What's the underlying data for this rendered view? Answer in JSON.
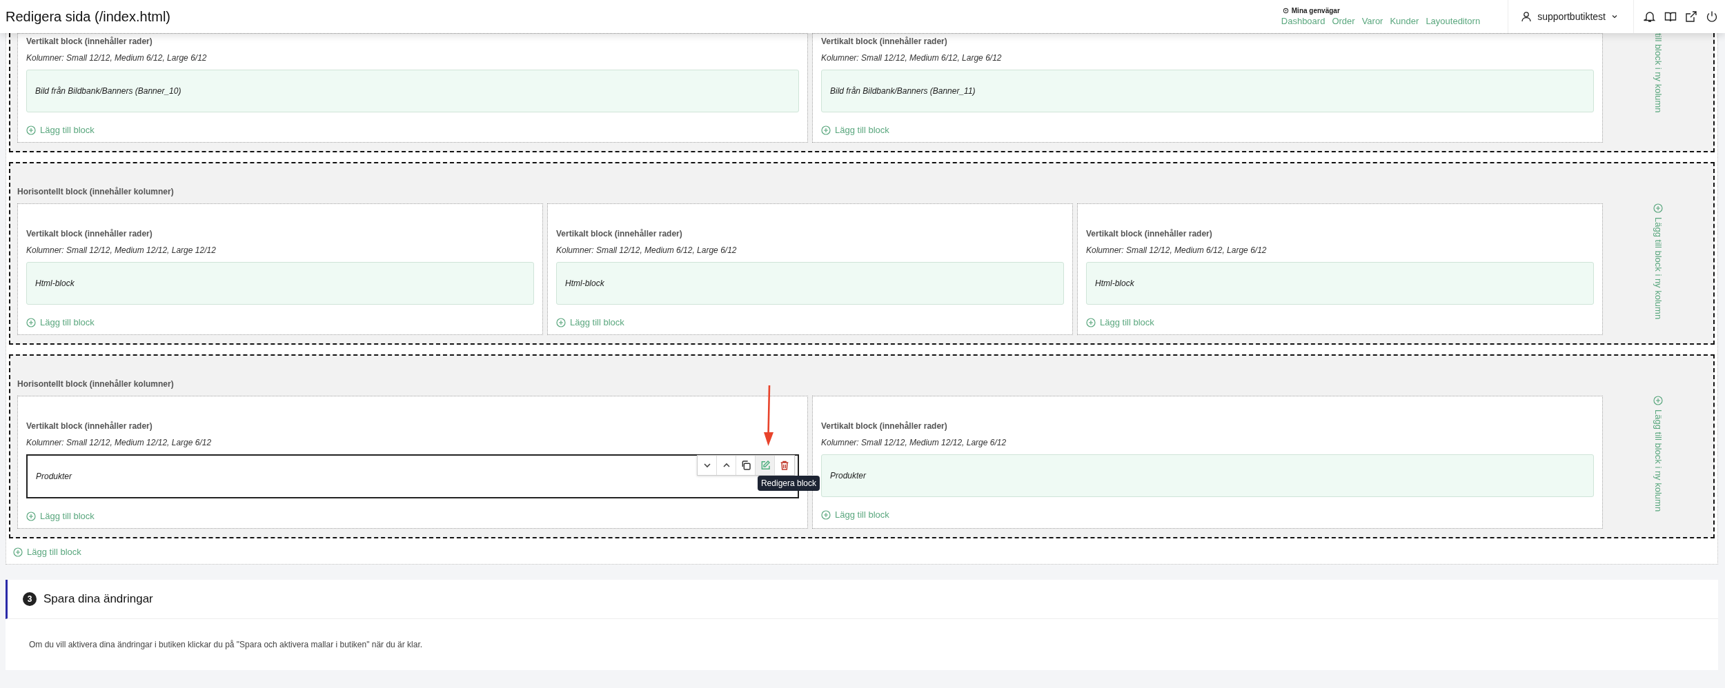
{
  "page_title": "Redigera sida (/index.html)",
  "shortcuts": {
    "title": "Mina genvägar",
    "links": [
      "Dashboard",
      "Order",
      "Varor",
      "Kunder",
      "Layouteditorn"
    ]
  },
  "user": {
    "name": "supportbutiktest"
  },
  "sections": [
    {
      "new_column": {
        "label": "till block i ny kolumn",
        "icon": false
      },
      "columns": [
        {
          "title": "Vertikalt block (innehåller rader)",
          "sizes": "Kolumner: Small 12/12, Medium 6/12, Large 6/12",
          "blocks": [
            {
              "label": "Bild från Bildbank/Banners (Banner_10)",
              "selected": false
            }
          ],
          "add_label": "Lägg till block"
        },
        {
          "title": "Vertikalt block (innehåller rader)",
          "sizes": "Kolumner: Small 12/12, Medium 6/12, Large 6/12",
          "blocks": [
            {
              "label": "Bild från Bildbank/Banners (Banner_11)",
              "selected": false
            }
          ],
          "add_label": "Lägg till block"
        }
      ]
    },
    {
      "title": "Horisontellt block (innehåller kolumner)",
      "new_column": {
        "label": "Lägg till block i ny kolumn",
        "icon": true
      },
      "columns": [
        {
          "title": "Vertikalt block (innehåller rader)",
          "sizes": "Kolumner: Small 12/12, Medium 12/12, Large 12/12",
          "blocks": [
            {
              "label": "Html-block",
              "selected": false
            }
          ],
          "add_label": "Lägg till block"
        },
        {
          "title": "Vertikalt block (innehåller rader)",
          "sizes": "Kolumner: Small 12/12, Medium 6/12, Large 6/12",
          "blocks": [
            {
              "label": "Html-block",
              "selected": false
            }
          ],
          "add_label": "Lägg till block"
        },
        {
          "title": "Vertikalt block (innehåller rader)",
          "sizes": "Kolumner: Small 12/12, Medium 6/12, Large 6/12",
          "blocks": [
            {
              "label": "Html-block",
              "selected": false
            }
          ],
          "add_label": "Lägg till block"
        }
      ]
    },
    {
      "title": "Horisontellt block (innehåller kolumner)",
      "new_column": {
        "label": "Lägg till block i ny kolumn",
        "icon": true
      },
      "columns": [
        {
          "title": "Vertikalt block (innehåller rader)",
          "sizes": "Kolumner: Small 12/12, Medium 12/12, Large 6/12",
          "blocks": [
            {
              "label": "Produkter",
              "selected": true,
              "tooltip": "Redigera block"
            }
          ],
          "add_label": "Lägg till block"
        },
        {
          "title": "Vertikalt block (innehåller rader)",
          "sizes": "Kolumner: Small 12/12, Medium 12/12, Large 6/12",
          "blocks": [
            {
              "label": "Produkter",
              "selected": false
            }
          ],
          "add_label": "Lägg till block"
        }
      ]
    }
  ],
  "add_block_label": "Lägg till block",
  "step": {
    "number": "3",
    "title": "Spara dina ändringar",
    "text": "Om du vill aktivera dina ändringar i butiken klickar du på \"Spara och aktivera mallar i butiken\" när du är klar."
  }
}
